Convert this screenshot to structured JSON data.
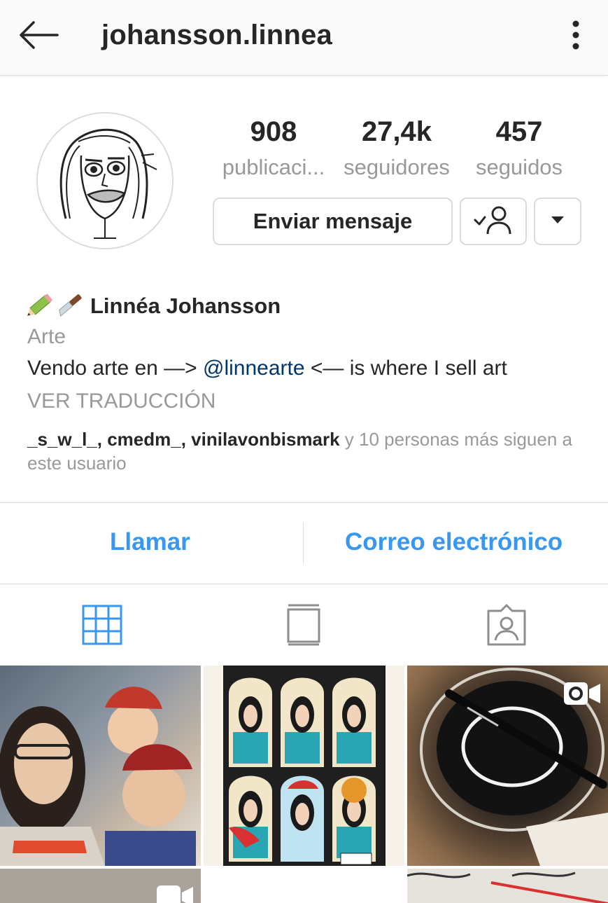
{
  "header": {
    "username": "johansson.linnea",
    "back_icon": "arrow-left-icon",
    "menu_icon": "kebab-menu-icon"
  },
  "stats": [
    {
      "value": "908",
      "label": "publicaci..."
    },
    {
      "value": "27,4k",
      "label": "seguidores"
    },
    {
      "value": "457",
      "label": "seguidos"
    }
  ],
  "buttons": {
    "message": "Enviar mensaje",
    "following_icon": "following-check-user-icon",
    "more_icon": "caret-down-icon"
  },
  "profile": {
    "emoji": "✏️🔪",
    "full_name": "Linnéa Johansson",
    "category": "Arte",
    "bio_before": "Vendo arte en —> ",
    "bio_mention": "@linnearte",
    "bio_after": " <— is where I sell art",
    "translate": "VER TRADUCCIÓN",
    "followed_by_users": [
      "_s_w_l_",
      "cmedm_",
      "vinilavonbismark"
    ],
    "followed_by_sep": ", ",
    "followed_by_rest": " y 10 personas más siguen a este usuario"
  },
  "actions": {
    "call": "Llamar",
    "email": "Correo electrónico"
  },
  "tabs": [
    {
      "icon": "grid-icon",
      "active": true
    },
    {
      "icon": "feed-icon",
      "active": false
    },
    {
      "icon": "tagged-icon",
      "active": false
    }
  ],
  "colors": {
    "accent": "#3897f0",
    "mention": "#003569",
    "muted": "#999999",
    "border": "#dbdbdb"
  }
}
